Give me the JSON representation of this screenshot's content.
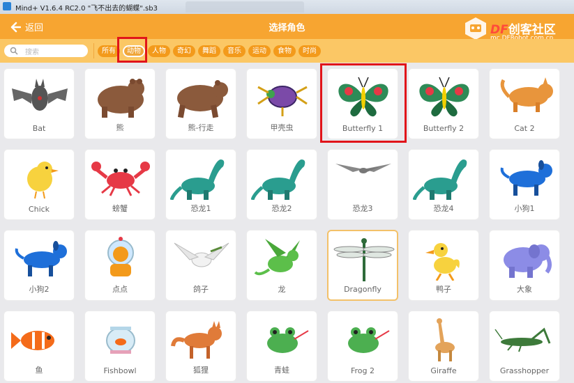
{
  "window": {
    "title": "Mind+ V1.6.4 RC2.0    \"飞不出去的蝴蝶\".sb3"
  },
  "header": {
    "back_label": "返回",
    "title": "选择角色"
  },
  "logo": {
    "brand_df": "DF",
    "brand_text": "创客社区",
    "url": "mc.DFRobot.com.cn"
  },
  "search": {
    "placeholder": "搜索"
  },
  "categories": [
    {
      "label": "所有",
      "active": false
    },
    {
      "label": "动物",
      "active": true
    },
    {
      "label": "人物",
      "active": false
    },
    {
      "label": "奇幻",
      "active": false
    },
    {
      "label": "舞蹈",
      "active": false
    },
    {
      "label": "音乐",
      "active": false
    },
    {
      "label": "运动",
      "active": false
    },
    {
      "label": "食物",
      "active": false
    },
    {
      "label": "时尚",
      "active": false
    }
  ],
  "sprites": [
    {
      "name": "Bat",
      "icon": "bat-icon"
    },
    {
      "name": "熊",
      "icon": "bear-icon"
    },
    {
      "name": "熊-行走",
      "icon": "bear-walking-icon"
    },
    {
      "name": "甲壳虫",
      "icon": "beetle-icon"
    },
    {
      "name": "Butterfly 1",
      "icon": "butterfly-icon",
      "highlighted": true
    },
    {
      "name": "Butterfly 2",
      "icon": "butterfly-icon"
    },
    {
      "name": "Cat 2",
      "icon": "cat-icon"
    },
    {
      "name": "Chick",
      "icon": "chick-icon"
    },
    {
      "name": "螃蟹",
      "icon": "crab-icon"
    },
    {
      "name": "恐龙1",
      "icon": "dinosaur-icon"
    },
    {
      "name": "恐龙2",
      "icon": "dinosaur-icon"
    },
    {
      "name": "恐龙3",
      "icon": "pterodactyl-icon"
    },
    {
      "name": "恐龙4",
      "icon": "dinosaur-icon"
    },
    {
      "name": "小狗1",
      "icon": "dog-icon"
    },
    {
      "name": "小狗2",
      "icon": "dog-icon"
    },
    {
      "name": "点点",
      "icon": "astronaut-dog-icon"
    },
    {
      "name": "鸽子",
      "icon": "dove-icon"
    },
    {
      "name": "龙",
      "icon": "dragon-icon"
    },
    {
      "name": "Dragonfly",
      "icon": "dragonfly-icon",
      "selected": true
    },
    {
      "name": "鸭子",
      "icon": "duck-icon"
    },
    {
      "name": "大象",
      "icon": "elephant-icon"
    },
    {
      "name": "鱼",
      "icon": "fish-icon"
    },
    {
      "name": "Fishbowl",
      "icon": "fishbowl-icon"
    },
    {
      "name": "狐狸",
      "icon": "fox-icon"
    },
    {
      "name": "青蛙",
      "icon": "frog-icon"
    },
    {
      "name": "Frog 2",
      "icon": "frog-icon"
    },
    {
      "name": "Giraffe",
      "icon": "giraffe-icon"
    },
    {
      "name": "Grasshopper",
      "icon": "grasshopper-icon"
    }
  ]
}
